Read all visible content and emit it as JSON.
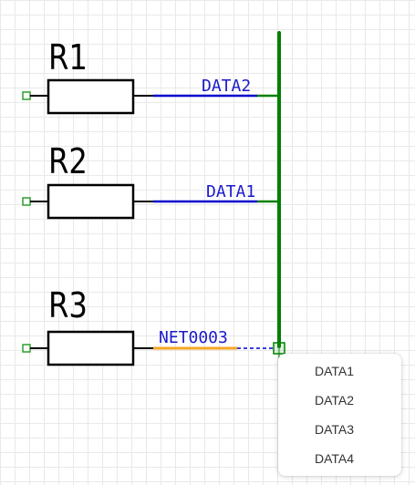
{
  "schematic": {
    "components": [
      {
        "ref": "R1",
        "net": "DATA2"
      },
      {
        "ref": "R2",
        "net": "DATA1"
      },
      {
        "ref": "R3",
        "net": "NET0003"
      }
    ],
    "colors": {
      "bus": "#008000",
      "wire": "#0000cc",
      "pending_wire": "#f5a623",
      "pin": "#2e9e2e",
      "body": "#000000"
    }
  },
  "net_dropdown": {
    "options": [
      "DATA1",
      "DATA2",
      "DATA3",
      "DATA4"
    ]
  }
}
